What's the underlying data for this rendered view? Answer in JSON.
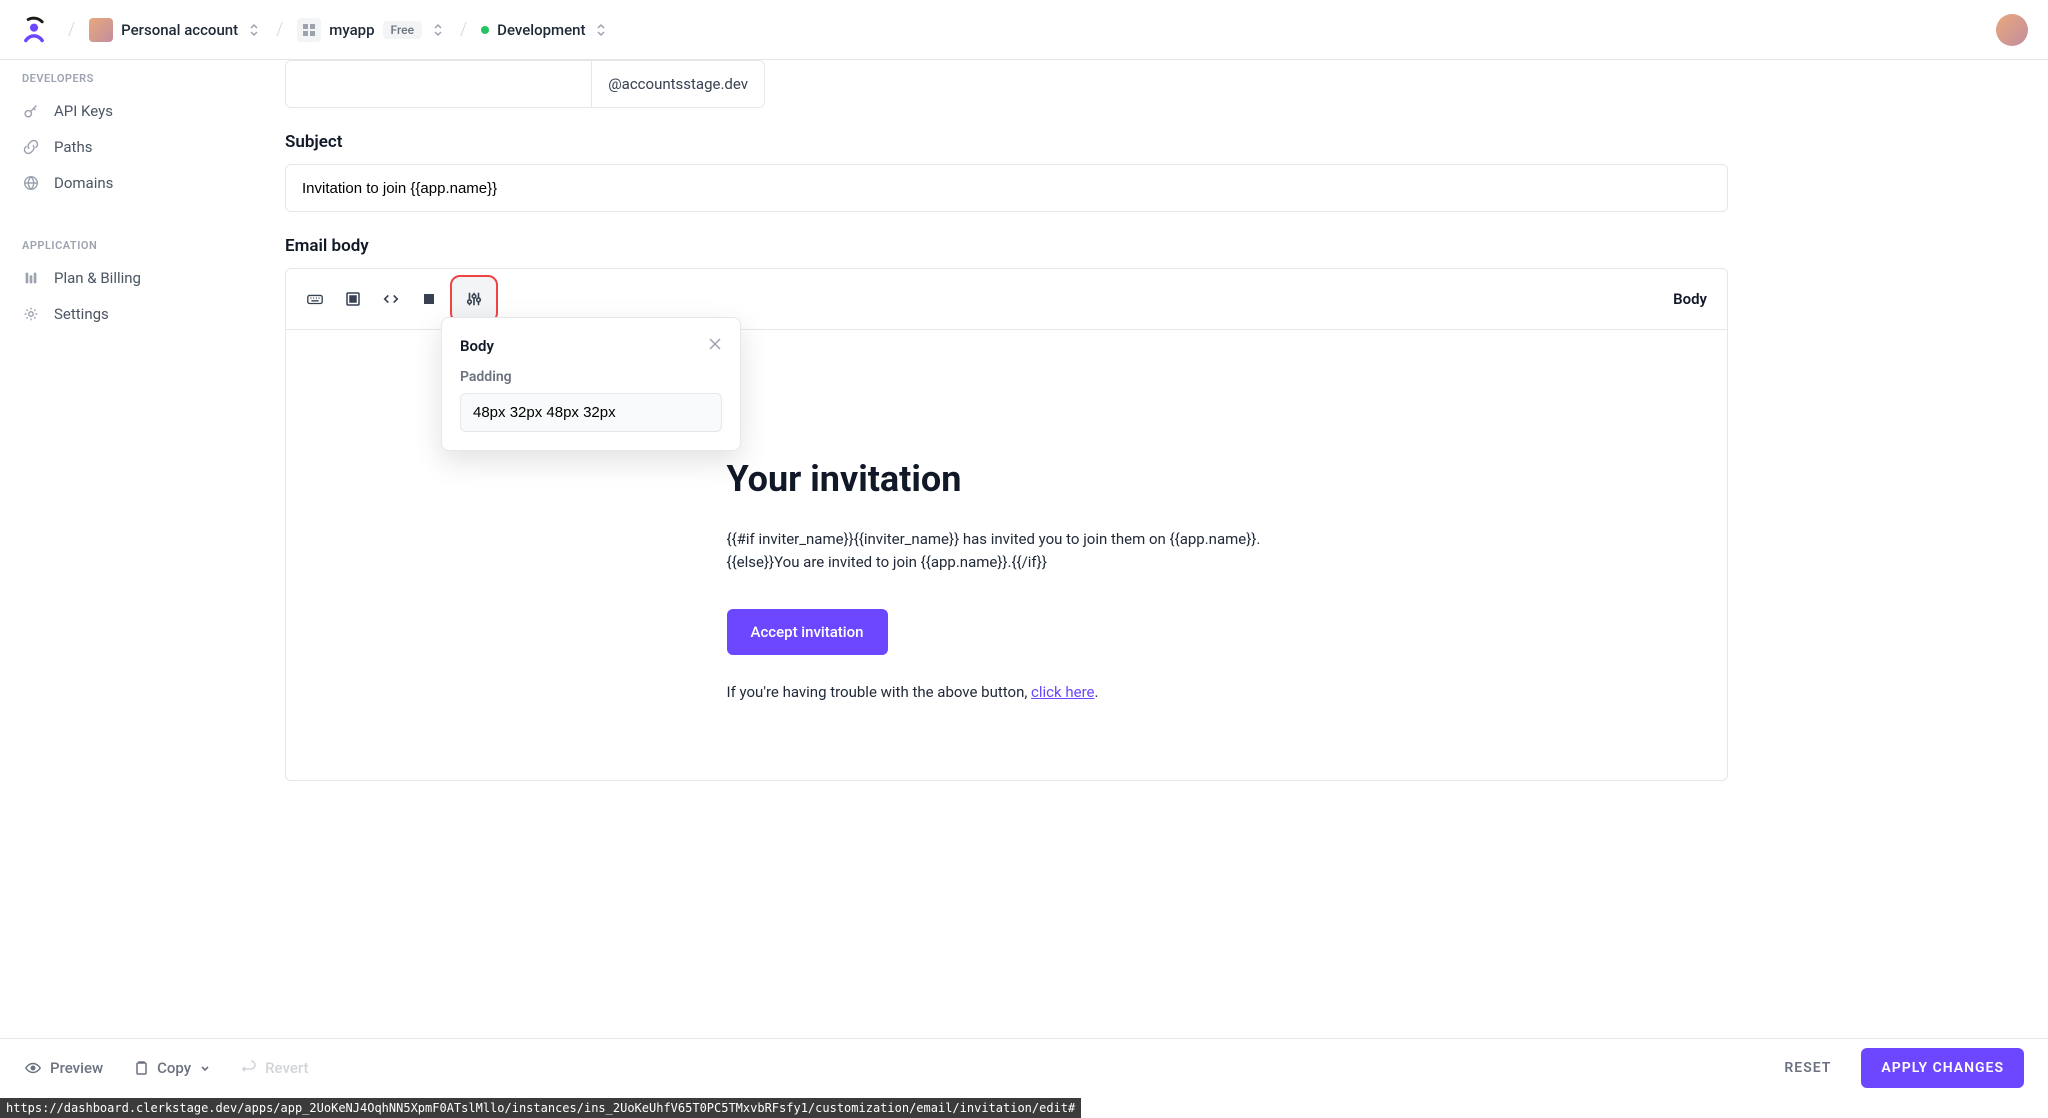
{
  "breadcrumb": {
    "account_label": "Personal account",
    "app_name": "myapp",
    "app_plan": "Free",
    "environment": "Development"
  },
  "sidebar": {
    "section_developers": "DEVELOPERS",
    "section_application": "APPLICATION",
    "items_dev": [
      {
        "label": "API Keys"
      },
      {
        "label": "Paths"
      },
      {
        "label": "Domains"
      }
    ],
    "items_app": [
      {
        "label": "Plan & Billing"
      },
      {
        "label": "Settings"
      }
    ]
  },
  "form": {
    "from_domain": "@accountsstage.dev",
    "subject_label": "Subject",
    "subject_value": "Invitation to join {{app.name}}",
    "body_label": "Email body",
    "toolbar_label": "Body"
  },
  "popover": {
    "title": "Body",
    "padding_label": "Padding",
    "padding_value": "48px 32px 48px 32px"
  },
  "email": {
    "title": "Your invitation",
    "body_line1": "{{#if inviter_name}}{{inviter_name}} has invited you to join them on {{app.name}}.",
    "body_line2": "{{else}}You are invited to join {{app.name}}.{{/if}}",
    "cta_label": "Accept invitation",
    "help_prefix": "If you're having trouble with the above button, ",
    "help_link": "click here",
    "help_suffix": "."
  },
  "footer": {
    "preview": "Preview",
    "copy": "Copy",
    "revert": "Revert",
    "reset": "RESET",
    "apply": "APPLY CHANGES"
  },
  "status_url": "https://dashboard.clerkstage.dev/apps/app_2UoKeNJ4OqhNN5XpmF0ATslMllo/instances/ins_2UoKeUhfV65T0PC5TMxvbRFsfy1/customization/email/invitation/edit#"
}
